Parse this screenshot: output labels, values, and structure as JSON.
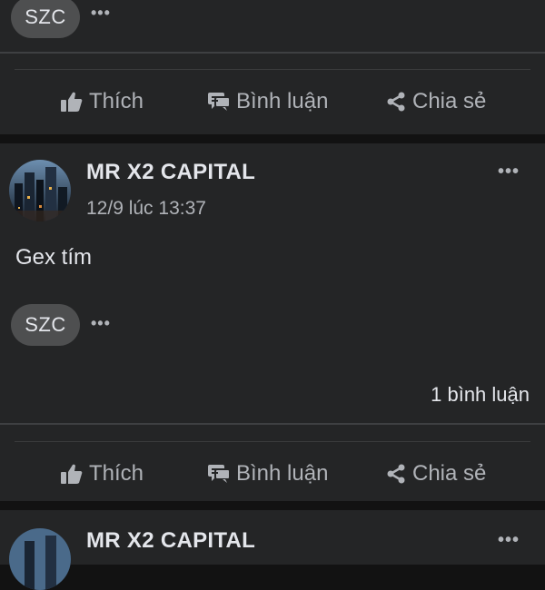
{
  "post_prev": {
    "reactor_initials": "SZC",
    "actions": {
      "like": "Thích",
      "comment": "Bình luận",
      "share": "Chia sẻ"
    }
  },
  "post": {
    "author": "MR X2 CAPITAL",
    "timestamp": "12/9 lúc 13:37",
    "text": "Gex tím",
    "reactor_initials": "SZC",
    "comment_count": "1 bình luận",
    "actions": {
      "like": "Thích",
      "comment": "Bình luận",
      "share": "Chia sẻ"
    }
  },
  "post_next": {
    "author": "MR X2 CAPITAL"
  },
  "icons": {
    "more": "more-options-icon",
    "like": "thumbs-up-icon",
    "comment": "comment-bubble-icon",
    "share": "share-icon"
  },
  "colors": {
    "background": "#121212",
    "card": "#242526",
    "pill": "#4e4f50",
    "text_primary": "#e4e6eb",
    "text_secondary": "#b0b3b8"
  }
}
